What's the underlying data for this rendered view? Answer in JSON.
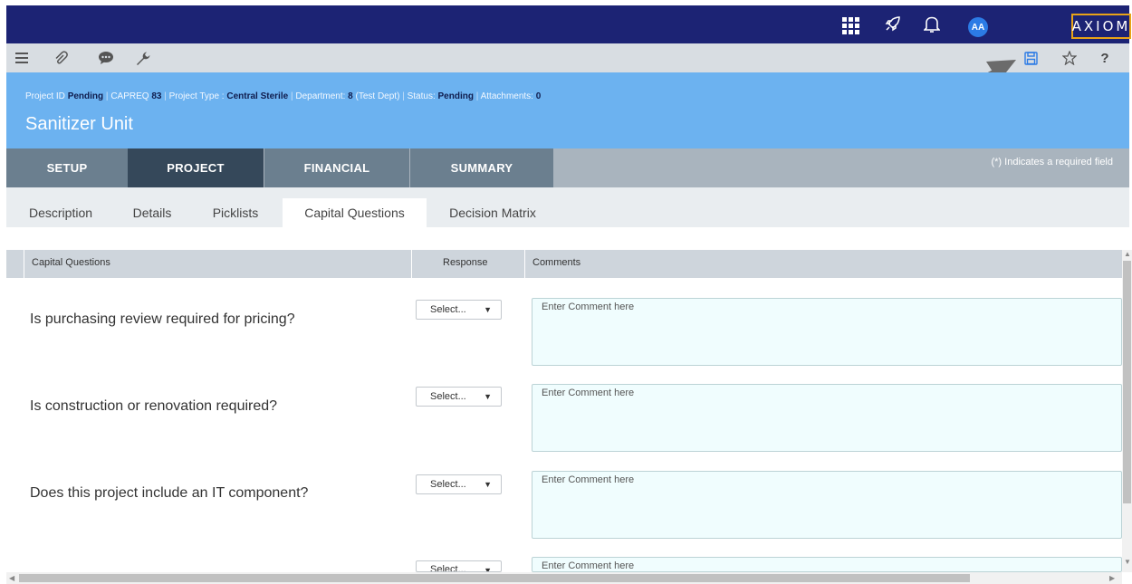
{
  "topbar": {
    "icons": [
      "apps-grid-icon",
      "rocket-icon",
      "bell-icon"
    ],
    "avatar_initials": "AA",
    "logo_text": "AXIOM"
  },
  "toolbar": {
    "left_icons": [
      "menu-icon",
      "paperclip-icon",
      "comment-icon",
      "wrench-icon"
    ],
    "right_icons": [
      "save-icon",
      "star-icon",
      "help-icon"
    ],
    "help_glyph": "?"
  },
  "header": {
    "project_id_label": "Project ID",
    "project_id_value": "Pending",
    "capreq_label": "CAPREQ",
    "capreq_value": "83",
    "project_type_label": "Project Type :",
    "project_type_value": "Central Sterile",
    "department_label": "Department:",
    "department_value": "8",
    "department_extra": "(Test Dept)",
    "status_label": "Status:",
    "status_value": "Pending",
    "attachments_label": "Attachments:",
    "attachments_value": "0",
    "title": "Sanitizer Unit"
  },
  "main_tabs": {
    "setup": "SETUP",
    "project": "PROJECT",
    "financial": "FINANCIAL",
    "summary": "SUMMARY",
    "required_note": "(*) Indicates a required field"
  },
  "sub_tabs": {
    "description": "Description",
    "details": "Details",
    "picklists": "Picklists",
    "capital_questions": "Capital Questions",
    "decision_matrix": "Decision Matrix"
  },
  "table": {
    "col_questions": "Capital Questions",
    "col_response": "Response",
    "col_comments": "Comments",
    "rows": [
      {
        "question": "Is purchasing review required for pricing?",
        "response": "Select...",
        "comment_placeholder": "Enter Comment here"
      },
      {
        "question": "Is construction or renovation required?",
        "response": "Select...",
        "comment_placeholder": "Enter Comment here"
      },
      {
        "question": "Does this project include an IT component?",
        "response": "Select...",
        "comment_placeholder": "Enter Comment here"
      },
      {
        "question": "",
        "response": "Select...",
        "comment_placeholder": "Enter Comment here"
      }
    ]
  }
}
